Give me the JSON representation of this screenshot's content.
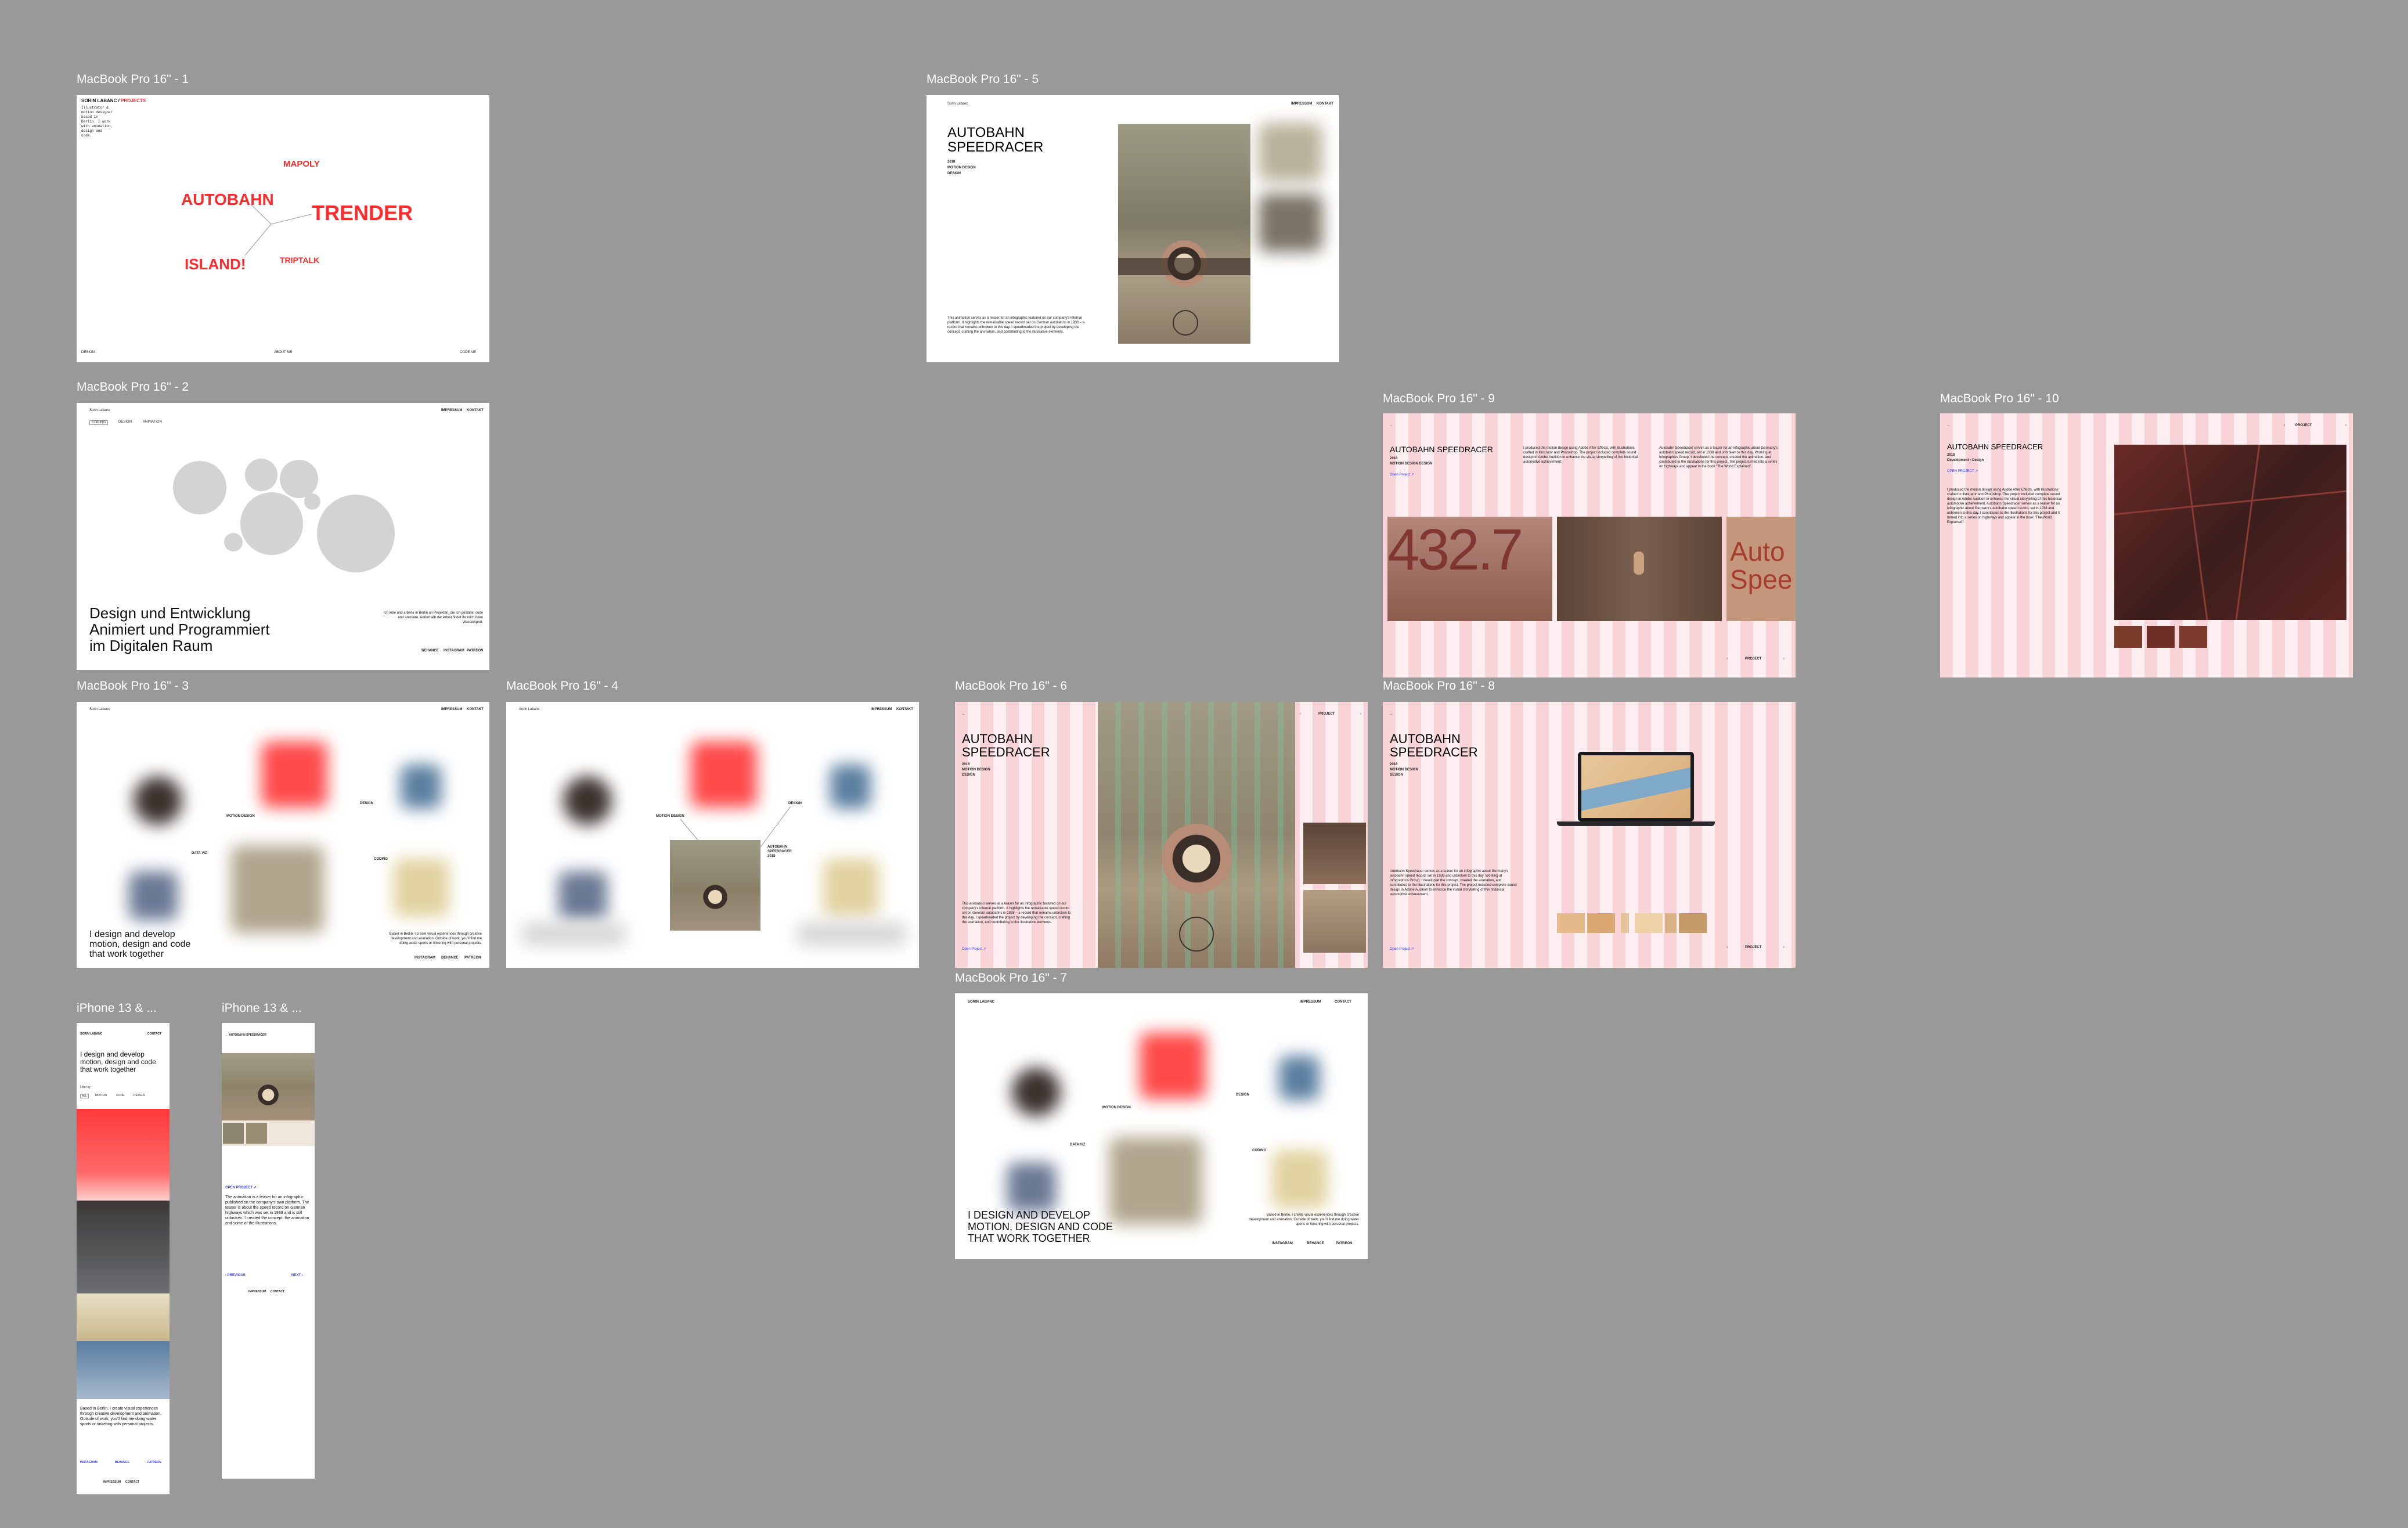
{
  "frames": {
    "f1": {
      "label": "MacBook Pro 16\" - 1",
      "brand": "SORIN LABANC",
      "projects": "PROJECTS",
      "blurb": "Illustrator & motion designer based in Berlin. I work with animation, design and code.",
      "words": [
        "MAPOLY",
        "AUTOBAHN",
        "TRENDER",
        "ISLAND!",
        "TRIPTALK"
      ],
      "footer": [
        "DESIGN",
        "ABOUT ME",
        "CODE ME"
      ]
    },
    "f2": {
      "label": "MacBook Pro 16\" - 2",
      "brand": "Sorin Labanc",
      "tabs": [
        "CODING",
        "DESIGN",
        "ANIMATION"
      ],
      "nav": [
        "IMPRESSUM",
        "KONTAKT"
      ],
      "headline": [
        "Design und Entwicklung",
        "Animiert und Programmiert",
        "im Digitalen Raum"
      ],
      "side": "Ich lebe und arbeite in Berlin an Projekten, die ich gestalte, code und animiere. Außerhalb der Arbeit findet ihr mich beim Wassersport.",
      "footer": [
        "BEHANCE",
        "INSTAGRAM",
        "PATREON"
      ]
    },
    "f3": {
      "label": "MacBook Pro 16\" - 3",
      "brand": "Sorin Labanc",
      "nav": [
        "IMPRESSUM",
        "KONTAKT"
      ],
      "tags": [
        "MOTION DESIGN",
        "DESIGN",
        "DATA VIZ",
        "CODING"
      ],
      "headline": [
        "I design and develop",
        "motion, design and code",
        "that work together"
      ],
      "side": "Based in Berlin, I create visual experiences through creative development and animation. Outside of work, you'll find me doing water sports or tinkering with personal projects.",
      "footer": [
        "INSTAGRAM",
        "BEHANCE",
        "PATREON"
      ]
    },
    "f4": {
      "label": "MacBook Pro 16\" - 4",
      "brand": "Sorin Labanc",
      "nav": [
        "IMPRESSUM",
        "KONTAKT"
      ],
      "tags": [
        "MOTION DESIGN",
        "DESIGN"
      ],
      "caption": [
        "AUTOBAHN",
        "SPEEDRACER",
        "2018"
      ]
    },
    "f5": {
      "label": "MacBook Pro 16\" - 5",
      "brand": "Sorin Labanc",
      "nav": [
        "IMPRESSUM",
        "KONTAKT"
      ],
      "title": [
        "AUTOBAHN",
        "SPEEDRACER"
      ],
      "meta": [
        "2018",
        "MOTION DESIGN",
        "DESIGN"
      ],
      "desc": "This animation serves as a teaser for an infographic featured on our company's internal platform. It highlights the remarkable speed record set on German autobahns in 1938 – a record that remains unbroken to this day. I spearheaded the project by developing the concept, crafting the animation, and contributing to the illustrative elements."
    },
    "f6": {
      "label": "MacBook Pro 16\" - 6",
      "title": [
        "AUTOBAHN",
        "SPEEDRACER"
      ],
      "meta": [
        "2018",
        "MOTION DESIGN",
        "DESIGN"
      ],
      "project": "PROJECT",
      "open": "Open Project",
      "desc": "This animation serves as a teaser for an infographic featured on our company's internal platform. It highlights the remarkable speed record set on German autobahns in 1938 – a record that remains unbroken to this day. I spearheaded the project by developing the concept, crafting the animation, and contributing to the illustrative elements."
    },
    "f7": {
      "label": "MacBook Pro 16\" - 7",
      "brand": "SORIN LABANC",
      "nav": [
        "IMPRESSUM",
        "CONTACT"
      ],
      "tags": [
        "MOTION DESIGN",
        "DESIGN",
        "DATA VIZ",
        "CODING"
      ],
      "headline": [
        "I DESIGN AND DEVELOP",
        "MOTION, DESIGN AND CODE",
        "THAT WORK TOGETHER"
      ],
      "side": "Based in Berlin, I create visual experiences through creative development and animation. Outside of work, you'll find me doing water sports or tinkering with personal projects.",
      "footer": [
        "INSTAGRAM",
        "BEHANCE",
        "PATREON"
      ]
    },
    "f8": {
      "label": "MacBook Pro 16\" - 8",
      "title": [
        "AUTOBAHN",
        "SPEEDRACER"
      ],
      "meta": [
        "2018",
        "MOTION DESIGN",
        "DESIGN"
      ],
      "project": "PROJECT",
      "open": "Open Project",
      "desc": "Autobahn Speedracer serves as a teaser for an infographic about Germany's autobahn speed record, set in 1938 and unbroken to this day. Working at Infographics Group, I developed the concept, created the animation, and contributed to the illustrations for this project. The project included complete sound design in Adobe Audition to enhance the visual storytelling of this historical automotive achievement."
    },
    "f9": {
      "label": "MacBook Pro 16\" - 9",
      "title": "AUTOBAHN SPEEDRACER",
      "meta": [
        "2018",
        "MOTION DESIGN DESIGN"
      ],
      "open": "Open Project",
      "col1": "I produced the motion design using Adobe After Effects, with illustrations crafted in Illustrator and Photoshop. The project included complete sound design in Adobe Audition to enhance the visual storytelling of this historical automotive achievement.",
      "col2": "Autobahn Speedracer serves as a teaser for an infographic about Germany's autobahn speed record, set in 1938 and unbroken to this day. Working at Infographics Group, I developed the concept, created the animation, and contributed to the illustrations for this project. The project turned into a series on highways and appear in the book \"The World Explained\".",
      "big1": "432.7",
      "big2": "Auto Spee",
      "project": "PROJECT"
    },
    "f10": {
      "label": "MacBook Pro 16\" - 10",
      "title": "AUTOBAHN SPEEDRACER",
      "meta": [
        "2018",
        "Development • Design"
      ],
      "open": "OPEN PROJECT",
      "desc": "I produced the motion design using Adobe After Effects, with illustrations crafted in Illustrator and Photoshop. The project included complete sound design in Adobe Audition to enhance the visual storytelling of this historical automotive achievement. Autobahn Speedracer serves as a teaser for an infographic about Germany's autobahn speed record, set in 1938 and unbroken to this day. I contributed to the illustrations for this project and it turned into a series on highways and appear in the book \"The World Explained\".",
      "project": "PROJECT"
    },
    "p1": {
      "label": "iPhone 13 & ...",
      "brand": "SORIN LABANC",
      "contact": "CONTACT",
      "headline": "I design and develop motion, design and code that work together",
      "filter": "Filter by",
      "tabs": [
        "ALL",
        "MOTION",
        "CODE",
        "DESIGN"
      ],
      "side": "Based in Berlin, I create visual experiences through creative development and animation. Outside of work, you'll find me doing water sports or tinkering with personal projects.",
      "links": [
        "INSTAGRAM",
        "BEHANCE",
        "PATREON"
      ],
      "footer": [
        "IMPRESSUM",
        "CONTACT"
      ]
    },
    "p2": {
      "label": "iPhone 13 & ...",
      "back": "AUTOBAHN SPEEDRACER",
      "open": "OPEN PROJECT",
      "desc": "The animation is a teaser for an infographic published on the company's own platform. The teaser is about the speed record on German highways which was set in 1938 and is still unbroken. I created the concept, the animation and some of the illustrations.",
      "prev": "PREVIOUS",
      "next": "NEXT",
      "footer": [
        "IMPRESSUM",
        "CONTACT"
      ]
    }
  },
  "colors": {
    "canvas": "#999999",
    "red": "#ff2a2a",
    "pink": "#fbe3e6",
    "blue": "#2a3bff"
  }
}
